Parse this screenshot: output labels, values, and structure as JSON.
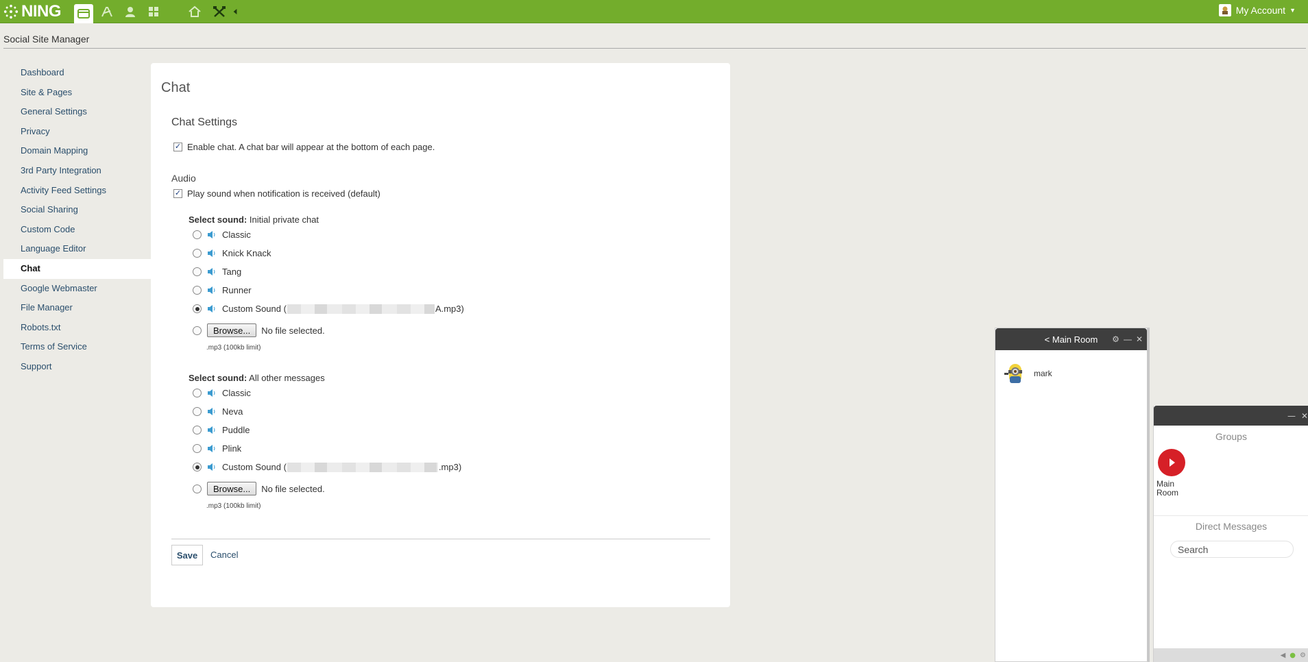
{
  "topbar": {
    "logo_text": "NING",
    "nav_icons": [
      "dashboard-tab-icon",
      "appearance-icon",
      "members-icon",
      "apps-grid-icon",
      "home-icon",
      "tools-icon",
      "collapse-arrow-icon"
    ],
    "account_label": "My Account",
    "brand_color": "#73ad2c"
  },
  "header": {
    "site_title": "Social Site Manager"
  },
  "sidebar": {
    "items": [
      {
        "label": "Dashboard"
      },
      {
        "label": "Site & Pages"
      },
      {
        "label": "General Settings"
      },
      {
        "label": "Privacy"
      },
      {
        "label": "Domain Mapping"
      },
      {
        "label": "3rd Party Integration"
      },
      {
        "label": "Activity Feed Settings"
      },
      {
        "label": "Social Sharing"
      },
      {
        "label": "Custom Code"
      },
      {
        "label": "Language Editor"
      },
      {
        "label": "Chat",
        "active": true
      },
      {
        "label": "Google Webmaster"
      },
      {
        "label": "File Manager"
      },
      {
        "label": "Robots.txt"
      },
      {
        "label": "Terms of Service"
      },
      {
        "label": "Support"
      }
    ]
  },
  "main": {
    "title": "Chat",
    "settings_title": "Chat Settings",
    "enable_chat": {
      "label": "Enable chat. A chat bar will appear at the bottom of each page.",
      "checked": true
    },
    "audio_title": "Audio",
    "play_sound": {
      "label": "Play sound when notification is received (default)",
      "checked": true
    },
    "private_chat": {
      "select_label": "Select sound:",
      "select_value": "Initial private chat",
      "options": [
        "Classic",
        "Knick Knack",
        "Tang",
        "Runner"
      ],
      "custom_prefix": "Custom Sound (",
      "custom_suffix": "A.mp3)",
      "selected": "Custom Sound",
      "browse_label": "Browse...",
      "no_file": "No file selected.",
      "limit": ".mp3 (100kb limit)"
    },
    "other_messages": {
      "select_label": "Select sound:",
      "select_value": "All other messages",
      "options": [
        "Classic",
        "Neva",
        "Puddle",
        "Plink"
      ],
      "custom_prefix": "Custom Sound (",
      "custom_suffix": ".mp3)",
      "selected": "Custom Sound",
      "browse_label": "Browse...",
      "no_file": "No file selected.",
      "limit": ".mp3 (100kb limit)"
    },
    "save_label": "Save",
    "cancel_label": "Cancel"
  },
  "chat_window": {
    "title": "< Main Room",
    "members": [
      {
        "name": "mark"
      }
    ]
  },
  "chat_panel": {
    "groups_title": "Groups",
    "room_label": "Main Room",
    "dm_title": "Direct Messages",
    "search_placeholder": "Search"
  }
}
